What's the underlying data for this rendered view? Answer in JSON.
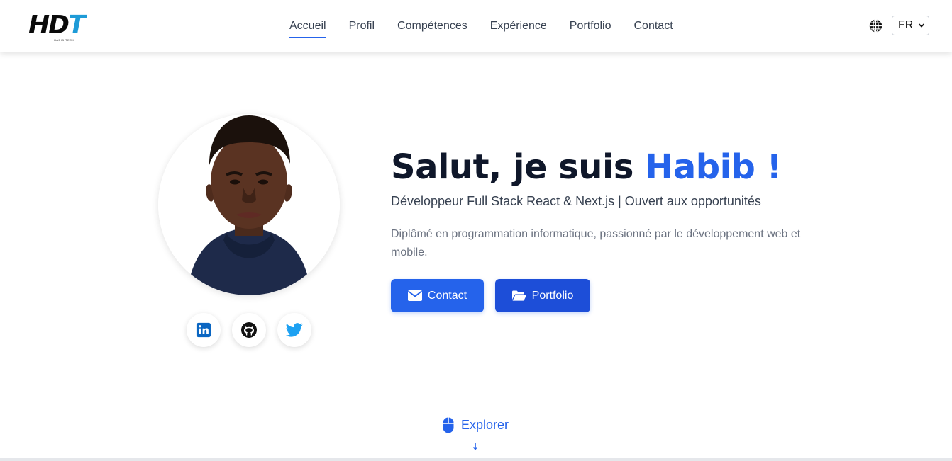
{
  "header": {
    "logo": {
      "text_main": "HD",
      "text_accent": "T",
      "subtitle": "HABIB TECH"
    },
    "nav": [
      {
        "label": "Accueil",
        "active": true
      },
      {
        "label": "Profil",
        "active": false
      },
      {
        "label": "Compétences",
        "active": false
      },
      {
        "label": "Expérience",
        "active": false
      },
      {
        "label": "Portfolio",
        "active": false
      },
      {
        "label": "Contact",
        "active": false
      }
    ],
    "language": {
      "icon": "globe-icon",
      "selected": "FR"
    }
  },
  "hero": {
    "title_prefix": "Salut, je suis ",
    "title_name": "Habib !",
    "subtitle": "Développeur Full Stack React & Next.js | Ouvert aux opportunités",
    "description": "Diplômé en programmation informatique, passionné par le développement web et mobile.",
    "buttons": {
      "contact": {
        "label": "Contact",
        "icon": "envelope-icon"
      },
      "portfolio": {
        "label": "Portfolio",
        "icon": "folder-open-icon"
      }
    },
    "socials": [
      {
        "name": "linkedin",
        "icon": "linkedin-icon",
        "color": "#0a66c2"
      },
      {
        "name": "github",
        "icon": "github-icon",
        "color": "#111111"
      },
      {
        "name": "twitter",
        "icon": "twitter-icon",
        "color": "#1da1f2"
      }
    ]
  },
  "explore": {
    "label": "Explorer",
    "icon": "mouse-icon"
  },
  "colors": {
    "accent": "#2563eb",
    "accent_dark": "#1d4ed8",
    "heading": "#0f172a",
    "muted": "#6b7280"
  }
}
